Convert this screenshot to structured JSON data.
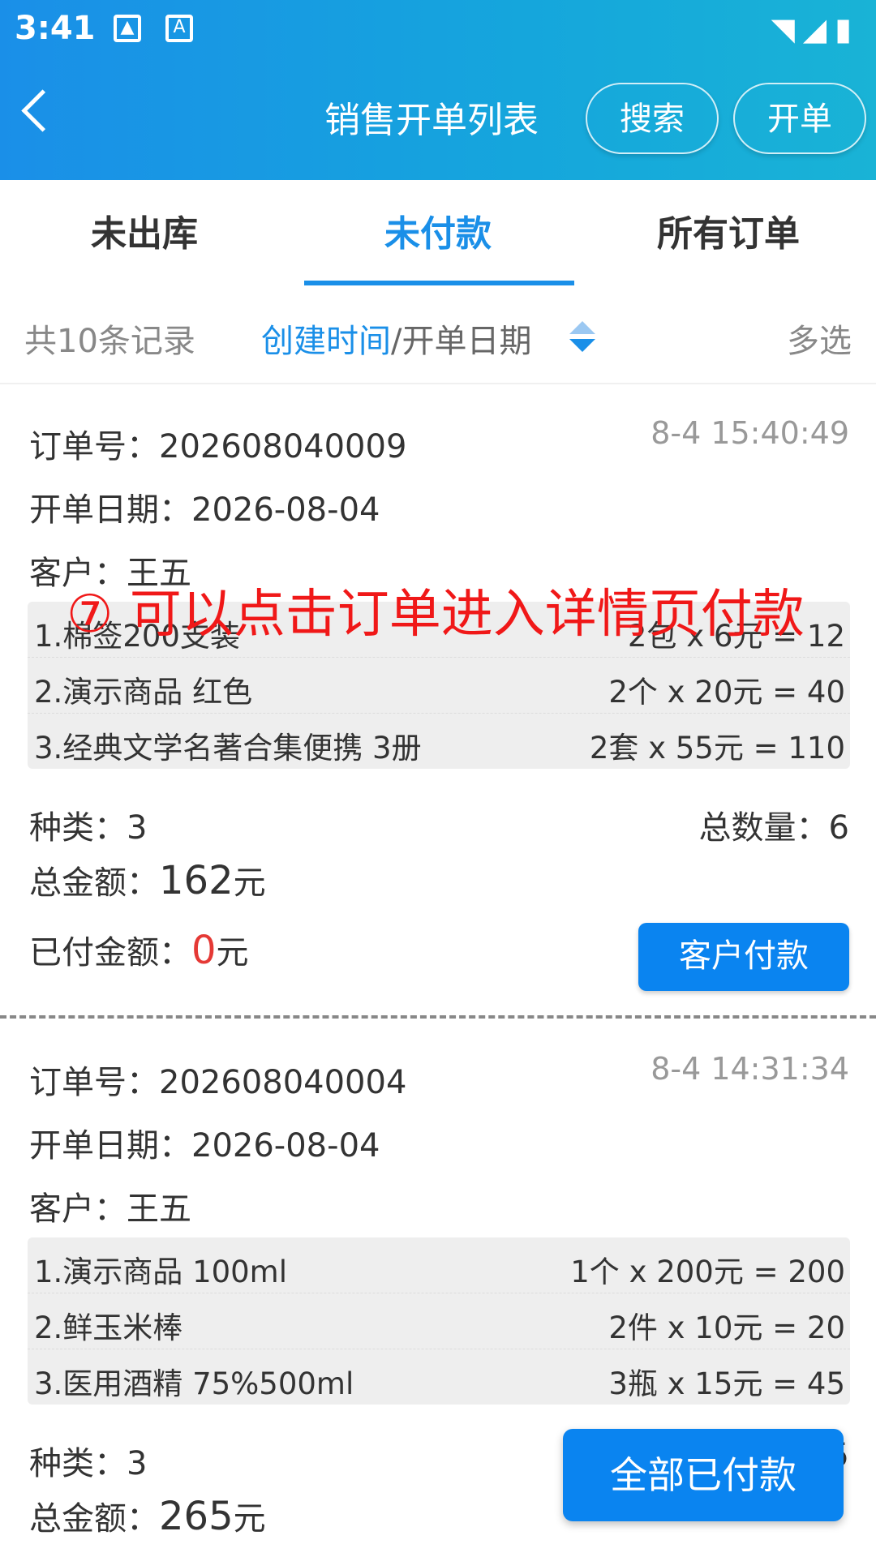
{
  "status_bar": {
    "time": "3:41",
    "icons": [
      "image-icon",
      "text-a-icon",
      "wifi-icon",
      "signal-icon",
      "battery-icon"
    ]
  },
  "header": {
    "title": "销售开单列表",
    "search_label": "搜索",
    "create_label": "开单"
  },
  "tabs": [
    {
      "label": "未出库"
    },
    {
      "label": "未付款"
    },
    {
      "label": "所有订单"
    }
  ],
  "filter": {
    "count": "共10条记录",
    "sort_active": "创建时间",
    "sort_sep": "/",
    "sort_other": "开单日期",
    "multi_select": "多选"
  },
  "overlay_note": "⑦ 可以点击订单进入详情页付款",
  "orders": [
    {
      "order_label": "订单号：",
      "order_no": "202608040009",
      "time": "8-4 15:40:49",
      "date_label": "开单日期：",
      "date": "2026-08-04",
      "customer_label": "客户：",
      "customer": "王五",
      "items": [
        {
          "name": "1.棉签200支装",
          "price": "2包 x 6元 = 12"
        },
        {
          "name": "2.演示商品 红色",
          "price": "2个 x 20元 = 40"
        },
        {
          "name": "3.经典文学名著合集便携 3册",
          "price": "2套 x 55元 = 110"
        }
      ],
      "kinds_label": "种类：",
      "kinds": "3",
      "qty_label": "总数量：",
      "qty": "6",
      "total_label": "总金额：",
      "total": "162",
      "unit": "元",
      "paid_label": "已付金额：",
      "paid": "0",
      "pay_button": "客户付款"
    },
    {
      "order_label": "订单号：",
      "order_no": "202608040004",
      "time": "8-4 14:31:34",
      "date_label": "开单日期：",
      "date": "2026-08-04",
      "customer_label": "客户：",
      "customer": "王五",
      "items": [
        {
          "name": "1.演示商品 100ml",
          "price": "1个 x 200元 = 200"
        },
        {
          "name": "2.鲜玉米棒",
          "price": "2件 x 10元 = 20"
        },
        {
          "name": "3.医用酒精 75%500ml",
          "price": "3瓶 x 15元 = 45"
        }
      ],
      "kinds_label": "种类：",
      "kinds": "3",
      "qty_partial": "5",
      "total_label": "总金额：",
      "total": "265",
      "unit": "元"
    }
  ],
  "float_button": "全部已付款",
  "colors": {
    "primary": "#1a8fe8",
    "button": "#0a84f0",
    "red": "#e53935"
  }
}
